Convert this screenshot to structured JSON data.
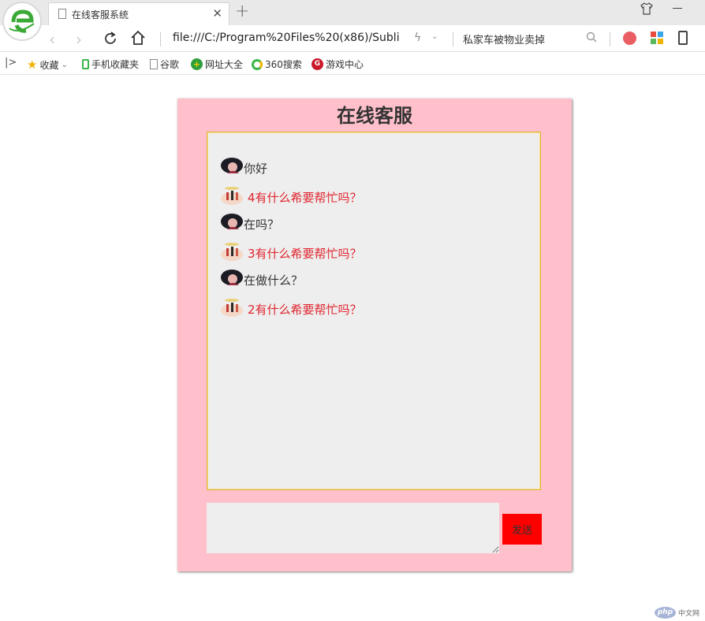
{
  "browser": {
    "tab_title": "在线客服系统",
    "url": "file:///C:/Program%20Files%20(x86)/Sublim",
    "search_text": "私家车被物业卖掉",
    "bookmarks": [
      {
        "label": "收藏",
        "icon": "star-icon"
      },
      {
        "label": "手机收藏夹",
        "icon": "phone-icon"
      },
      {
        "label": "谷歌",
        "icon": "page-icon"
      },
      {
        "label": "网址大全",
        "icon": "globe-icon"
      },
      {
        "label": "360搜索",
        "icon": "search-ring-icon"
      },
      {
        "label": "游戏中心",
        "icon": "game-icon"
      }
    ]
  },
  "chat": {
    "title": "在线客服",
    "messages": [
      {
        "from": "user",
        "text": "你好"
      },
      {
        "from": "agent",
        "text": "4有什么希要帮忙吗？"
      },
      {
        "from": "user",
        "text": "在吗？"
      },
      {
        "from": "agent",
        "text": "3有什么希要帮忙吗？"
      },
      {
        "from": "user",
        "text": "在做什么？"
      },
      {
        "from": "agent",
        "text": "2有什么希要帮忙吗？"
      }
    ],
    "input_value": "",
    "send_label": "发送"
  },
  "colors": {
    "panel_bg": "#ffc0cb",
    "chat_bg": "#eeeeee",
    "agent_text": "#e0242e",
    "send_button": "#ff0000"
  },
  "watermark": {
    "logo": "php",
    "text": "中文网"
  }
}
